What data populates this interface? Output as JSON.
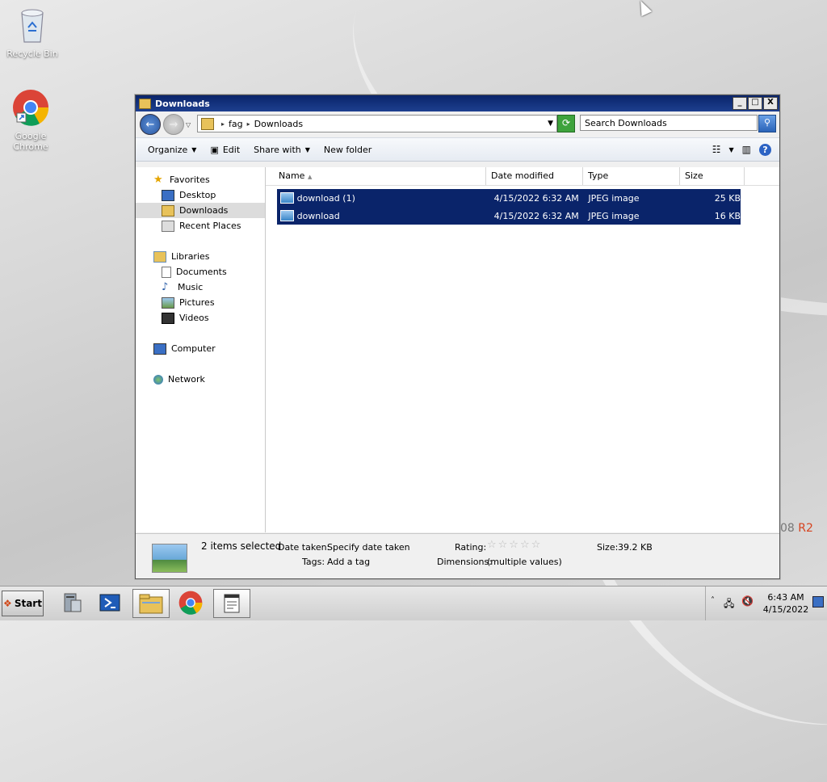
{
  "desktop": {
    "icons": [
      {
        "label": "Recycle Bin",
        "icon": "recycle-bin-icon"
      },
      {
        "label": "Google Chrome",
        "icon": "chrome-icon"
      }
    ],
    "watermark_text": "08",
    "watermark_r2": "R2"
  },
  "window": {
    "title": "Downloads",
    "caption": {
      "minimize": "_",
      "maximize": "□",
      "close": "X"
    },
    "address": {
      "segments": [
        "fag",
        "Downloads"
      ]
    },
    "search_placeholder": "Search Downloads",
    "toolbar": {
      "organize": "Organize",
      "edit": "Edit",
      "share_with": "Share with",
      "new_folder": "New folder",
      "help": "?"
    },
    "nav": {
      "favorites": "Favorites",
      "desktop": "Desktop",
      "downloads": "Downloads",
      "recent_places": "Recent Places",
      "libraries": "Libraries",
      "documents": "Documents",
      "music": "Music",
      "pictures": "Pictures",
      "videos": "Videos",
      "computer": "Computer",
      "network": "Network"
    },
    "columns": [
      "Name",
      "Date modified",
      "Type",
      "Size"
    ],
    "files": [
      {
        "name": "download (1)",
        "date": "4/15/2022 6:32 AM",
        "type": "JPEG image",
        "size": "25 KB"
      },
      {
        "name": "download",
        "date": "4/15/2022 6:32 AM",
        "type": "JPEG image",
        "size": "16 KB"
      }
    ],
    "details": {
      "selected": "2 items selected",
      "date_taken_label": "Date taken:",
      "date_taken_value": "Specify date taken",
      "tags_label": "Tags:",
      "tags_value": "Add a tag",
      "rating_label": "Rating:",
      "rating_stars": "☆☆☆☆☆",
      "dimensions_label": "Dimensions:",
      "dimensions_value": "(multiple values)",
      "size_label": "Size:",
      "size_value": "39.2 KB"
    }
  },
  "taskbar": {
    "start": "Start",
    "time": "6:43 AM",
    "date": "4/15/2022"
  }
}
